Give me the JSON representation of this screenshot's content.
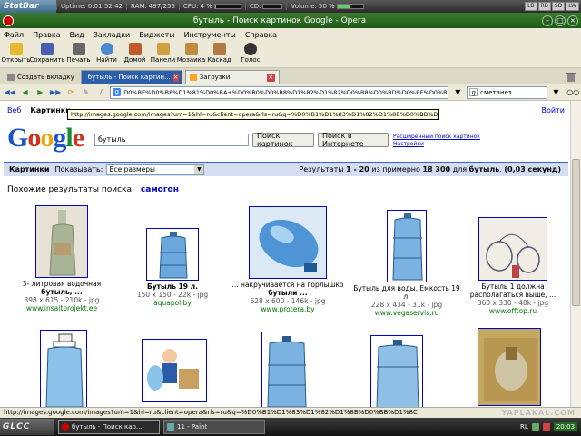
{
  "statbar": {
    "brand": "StatBar",
    "uptime_label": "Uptime:",
    "uptime_value": "0:01:52:42",
    "ram_label": "RAM:",
    "ram_value": "497/256",
    "cpu_label": "CPU:",
    "cpu_value": "4 %",
    "cd_label": "CD:",
    "volume_label": "Volume:",
    "volume_value": "50 %",
    "tray": [
      "LB",
      "RB",
      "SD",
      "LW"
    ]
  },
  "window": {
    "title": "бутыль - Поиск картинок Google - Opera"
  },
  "menu": [
    "Файл",
    "Правка",
    "Вид",
    "Закладки",
    "Виджеты",
    "Инструменты",
    "Справка"
  ],
  "toolbar": [
    {
      "label": "Открыть",
      "icon": "open-folder-icon",
      "color": "#e8b830"
    },
    {
      "label": "Сохранить",
      "icon": "save-icon",
      "color": "#4a5fb0"
    },
    {
      "label": "Печать",
      "icon": "print-icon",
      "color": "#666666"
    },
    {
      "label": "Найти",
      "icon": "find-icon",
      "color": "#4a88d0"
    },
    {
      "label": "Домой",
      "icon": "home-icon",
      "color": "#c05a2a"
    },
    {
      "label": "Панели",
      "icon": "panels-icon",
      "color": "#d0a040"
    },
    {
      "label": "Мозаика",
      "icon": "tile-icon",
      "color": "#c08a40"
    },
    {
      "label": "Каскад",
      "icon": "cascade-icon",
      "color": "#b07a40"
    },
    {
      "label": "Голос",
      "icon": "voice-icon",
      "color": "#333333"
    }
  ],
  "tabs": {
    "new_tab": "Создать вкладку",
    "active": "бутыль - Поиск картин...",
    "downloads": "Загрузки"
  },
  "address": {
    "url": "D0%BE%D0%B8%D1%81%D0%BA+%D0%B0%D0%B8%D1%82%D1%82%D0%B8%D0%BD%D0%BE%D0%BA",
    "search_value": "сметанез"
  },
  "google": {
    "nav": [
      "Веб",
      "Картинки"
    ],
    "signin": "Войти",
    "tooltip": "http://images.google.com/images?um=1&hl=ru&client=opera&rls=ru&q=%D0%B1%D1%83%D1%82%D1%8B%D0%BB%D1%8...",
    "logo": [
      "G",
      "o",
      "o",
      "g",
      "l",
      "e"
    ],
    "query": "бутыль",
    "btn_images": "Поиск картинок",
    "btn_web": "Поиск в Интернете",
    "adv_1": "Расширенный поиск картинок",
    "adv_2": "Настройки",
    "results_label": "Картинки",
    "show_label": "Показывать:",
    "size_select": "Все размеры",
    "results_prefix": "Результаты",
    "results_range": "1 - 20",
    "results_mid": "из примерно",
    "results_total": "18 300",
    "results_for": "для",
    "results_query": "бутыль",
    "results_time": "(0,03 секунд)",
    "related_label": "Похожие результаты поиска:",
    "related_term": "самогон"
  },
  "results": [
    {
      "cap1": "3- литровая водочная",
      "cap2": "бутыль, ...",
      "meta": "398 x 615 - 210k - jpg",
      "site": "www.insaitprojekt.ee"
    },
    {
      "cap1": "Бутыль 19 л.",
      "cap2": "",
      "meta": "150 x 150 - 22k - jpg",
      "site": "aquapol.by"
    },
    {
      "cap1": "... накручивается на горлышко",
      "cap2": "бутыли ...",
      "meta": "628 x 600 - 146k - jpg",
      "site": "www.protera.by"
    },
    {
      "cap1": "Бутыль для воды. Емкость 19",
      "cap2": "л.",
      "meta": "228 x 434 - 31k - jpg",
      "site": "www.vegaservis.ru"
    },
    {
      "cap1": "Бутыль 1 должна",
      "cap2": "располагаться выше, ...",
      "meta": "360 x 330 - 40k - jpg",
      "site": "www.offtop.ru"
    }
  ],
  "status": {
    "url": "http://images.google.com/images?um=1&hl=ru&client=opera&rls=ru&q=%D0%B1%D1%83%D1%82%D1%8B%D0%BB%D1%8C"
  },
  "taskbar": {
    "start": "GLCC",
    "tasks": [
      "бутыль - Поиск кар...",
      "11 - Paint"
    ],
    "lang": "RL",
    "clock": "20:03",
    "watermark": "YAPLAKAL.COM"
  }
}
